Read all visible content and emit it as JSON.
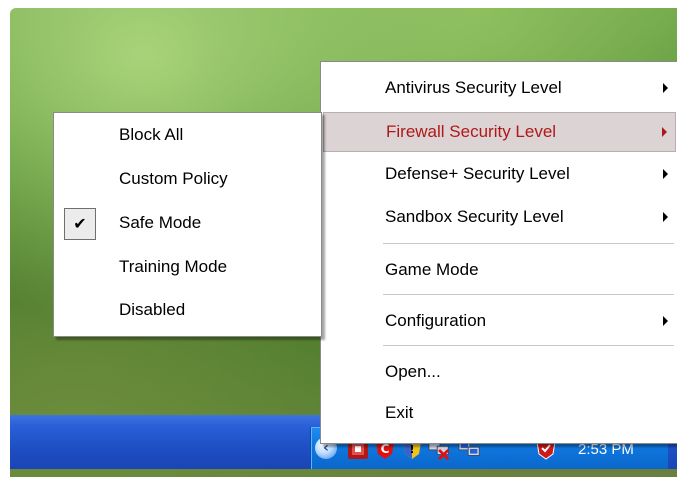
{
  "taskbar": {
    "clock": "2:53 PM"
  },
  "tray_icons": [
    "expand-chevron-icon",
    "comodo-firewall-icon",
    "comodo-c-shield-icon",
    "security-shield-icon",
    "network-disconnected-icon",
    "network-icon",
    "comodo-red-shield-icon"
  ],
  "main_menu": {
    "items": [
      {
        "label": "Antivirus Security Level",
        "submenu": true
      },
      {
        "label": "Firewall Security Level",
        "submenu": true,
        "highlighted": true
      },
      {
        "label": "Defense+ Security Level",
        "submenu": true
      },
      {
        "label": "Sandbox Security Level",
        "submenu": true
      },
      {
        "label": "Game Mode"
      },
      {
        "label": "Configuration",
        "submenu": true
      },
      {
        "label": "Open..."
      },
      {
        "label": "Exit"
      }
    ]
  },
  "firewall_submenu": {
    "items": [
      {
        "label": "Block All"
      },
      {
        "label": "Custom Policy"
      },
      {
        "label": "Safe Mode",
        "checked": true
      },
      {
        "label": "Training Mode"
      },
      {
        "label": "Disabled"
      }
    ]
  },
  "colors": {
    "highlight_text": "#b01818",
    "highlight_bg": "#dcd4d4",
    "taskbar": "#2a5fd8",
    "tray": "#0f78e0"
  }
}
